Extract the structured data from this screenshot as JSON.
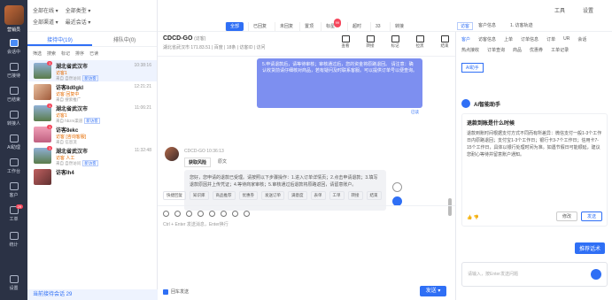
{
  "rail": {
    "user_name": "营销员",
    "items": [
      {
        "label": "会话中",
        "badge": ""
      },
      {
        "label": "已接待",
        "badge": ""
      },
      {
        "label": "已结束",
        "badge": ""
      },
      {
        "label": "转接人",
        "badge": ""
      },
      {
        "label": "AI助理",
        "badge": ""
      },
      {
        "label": "工作台",
        "badge": ""
      },
      {
        "label": "客户",
        "badge": ""
      },
      {
        "label": "工单",
        "badge": "29"
      },
      {
        "label": "统计",
        "badge": ""
      },
      {
        "label": "设置",
        "badge": ""
      }
    ]
  },
  "list": {
    "filter1": "全部在线 ▾",
    "filter2": "全部类型 ▾",
    "filter3": "全部渠道 ▾",
    "filter4": "最近会话 ▾",
    "tab_active": "接待中(19)",
    "tab_other": "排队中(0)",
    "tools": [
      "筛选",
      "搜索",
      "标记",
      "排序",
      "已读"
    ],
    "sessions": [
      {
        "name": "湖北省武汉市",
        "time": "10:38:16",
        "sub": "访客1",
        "meta": "来自 自然访问",
        "tag": "新访客",
        "badge": "1"
      },
      {
        "name": "访客8d0gkl",
        "time": "12:21:21",
        "sub": "访客 回复中",
        "meta": "来自 搜索推广",
        "tag": "",
        "badge": ""
      },
      {
        "name": "湖北省武汉市",
        "time": "11:06:21",
        "sub": "访客1",
        "meta": "来自 hbzm渠道",
        "tag": "新访客",
        "badge": "1"
      },
      {
        "name": "访客8ekc",
        "time": "",
        "sub": "访客 [咨询客服]",
        "meta": "来自 信息流",
        "tag": "",
        "badge": "1"
      },
      {
        "name": "湖北省武汉市",
        "time": "11:32:48",
        "sub": "访客 人工",
        "meta": "来自 自然访问",
        "tag": "新访客",
        "badge": "1"
      },
      {
        "name": "访客Ih4",
        "time": "",
        "sub": "",
        "meta": "",
        "tag": "",
        "badge": ""
      }
    ],
    "footer": "当前接待会话 29"
  },
  "topbar": {
    "pills": [
      "全部",
      "已回复",
      "未回复",
      "置顶",
      "标星",
      "超时",
      "33",
      "转接"
    ],
    "pill_badge": "99",
    "right1": "工具",
    "right2": "设置"
  },
  "chat": {
    "name": "CDCD-GO",
    "name_suffix": "(访客)",
    "meta": "湖北省武汉市  171.83.51  | 百度  | 18条  | 访客ID  | 访问",
    "actions": [
      "查看",
      "转接",
      "标记",
      "拉黑",
      "结束"
    ],
    "out_message": "5.申请退款后，请等待审核；审核通过后，您的资金将原路退回。\n请注意：确认收货前请仔细核对商品，若有疑问及时联系客服。可以提供订单号以便查询。",
    "read_status": "已读",
    "in_meta": "CDCD-GO  10:36:13",
    "in_tab_active": "获取风险",
    "in_tab_other": "原文",
    "in_message": "您好，您申请的退款已受理。请按照以下步骤操作：1.进入订单详情页；2.点击申请退款；3.填写退款原因并上传凭证；4.等待商家审核；5.审核通过后退款将原路返回，请留意账户。",
    "quick_tools": [
      "快捷回复",
      "知识库",
      "商品推荐",
      "优惠券",
      "发送订单",
      "满意度",
      "表单",
      "工单",
      "转接",
      "结束"
    ],
    "composer_hint": "Ctrl + Enter 发送消息，Enter换行",
    "checkbox_label": "回车发送",
    "send": "发送 ▾"
  },
  "right": {
    "header_tabs": [
      "访客",
      "客户信息",
      "1. 访客轨迹"
    ],
    "tabs": [
      "客户",
      "访客信息",
      "上单",
      "订单信息",
      "订单",
      "UR",
      "会话",
      "热点接收",
      "订单查询",
      "商品",
      "优惠券",
      "工单记录"
    ],
    "ai_tab": "AI助手",
    "ai_title": "AI智能助手",
    "question": "退款到账是什么时候",
    "answer": "退款到账时间根据支付方式不同而有所差异：微信支付一般1-3个工作日内原路退回；支付宝1-3个工作日；银行卡3-7个工作日；信用卡7-15个工作日，具体以银行处理时间为准。如遇节假日可能顺延，建议您耐心等待并留意账户通知。",
    "btn_modify": "修改",
    "btn_send": "发送",
    "tip": "推荐话术",
    "input_placeholder": "请输入，按Enter发送问题"
  }
}
